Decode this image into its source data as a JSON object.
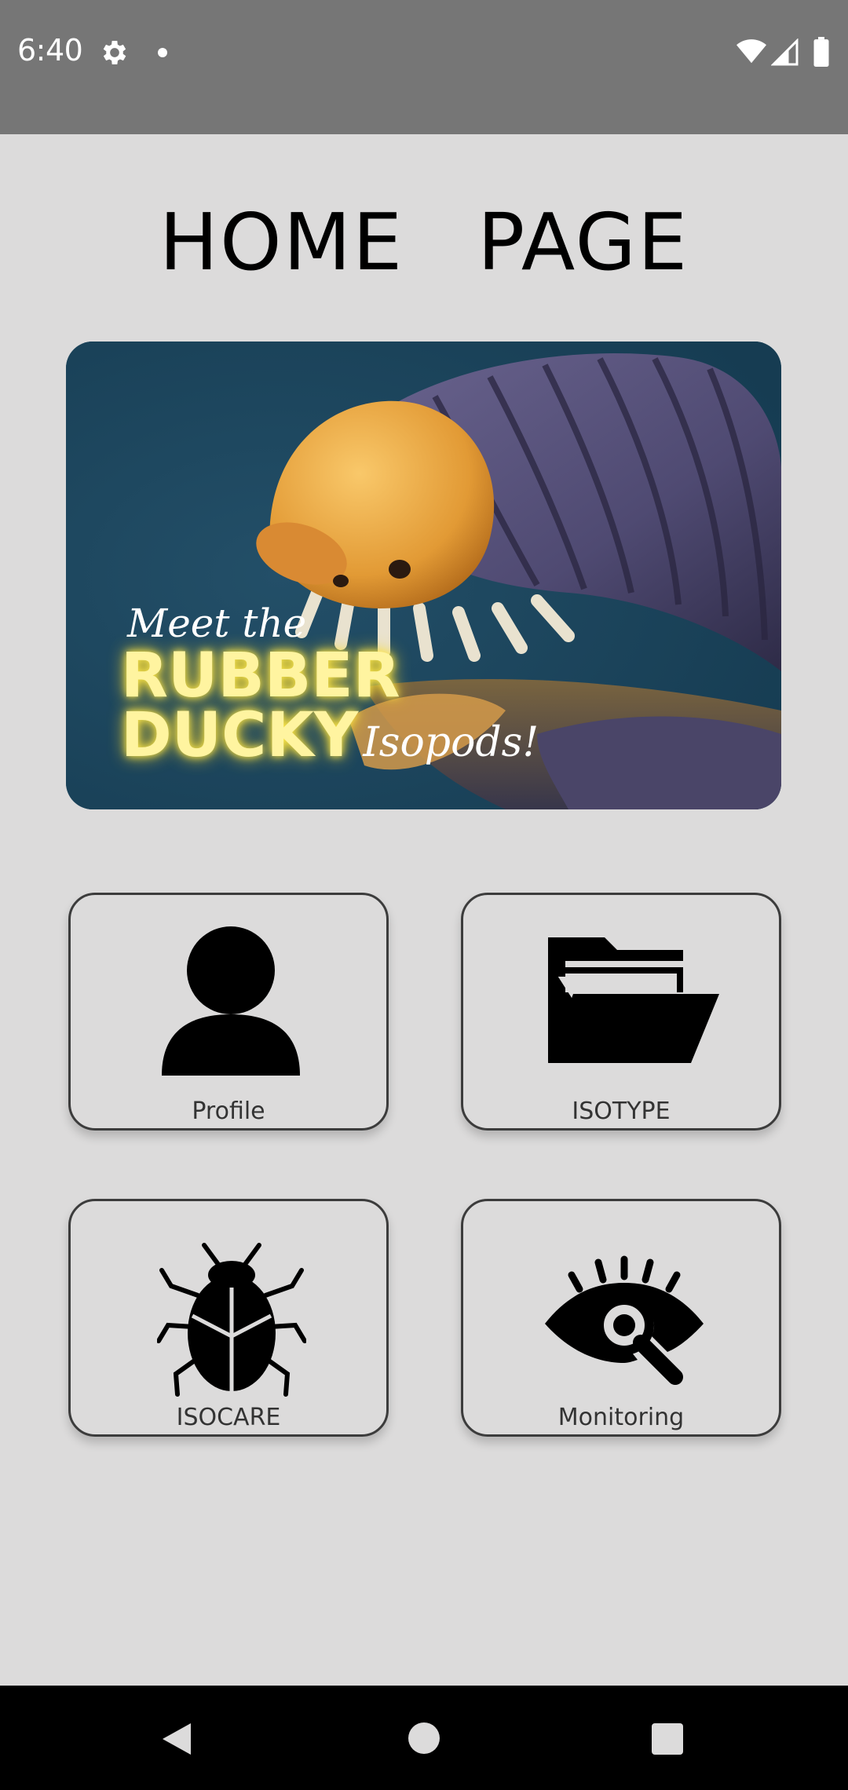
{
  "status_bar": {
    "time": "6:40",
    "icons": [
      "gear-icon",
      "notification-dot-icon",
      "wifi-icon",
      "signal-icon",
      "battery-icon"
    ]
  },
  "page": {
    "title": "HOME   PAGE"
  },
  "banner": {
    "line1": "Meet the",
    "line2": "RUBBER",
    "line3": "DUCKY",
    "line4": "Isopods!"
  },
  "tiles": [
    {
      "label": "Profile",
      "icon": "person-icon"
    },
    {
      "label": "ISOTYPE",
      "icon": "folder-icon"
    },
    {
      "label": "ISOCARE",
      "icon": "bug-icon"
    },
    {
      "label": "Monitoring",
      "icon": "eye-search-icon"
    }
  ],
  "nav_bar": {
    "icons": [
      "back-icon",
      "home-icon",
      "recents-icon"
    ]
  },
  "colors": {
    "status_bar": "#767676",
    "background": "#dcdbdb",
    "banner_bg": "#1b4a63",
    "nav_bar": "#000000"
  }
}
